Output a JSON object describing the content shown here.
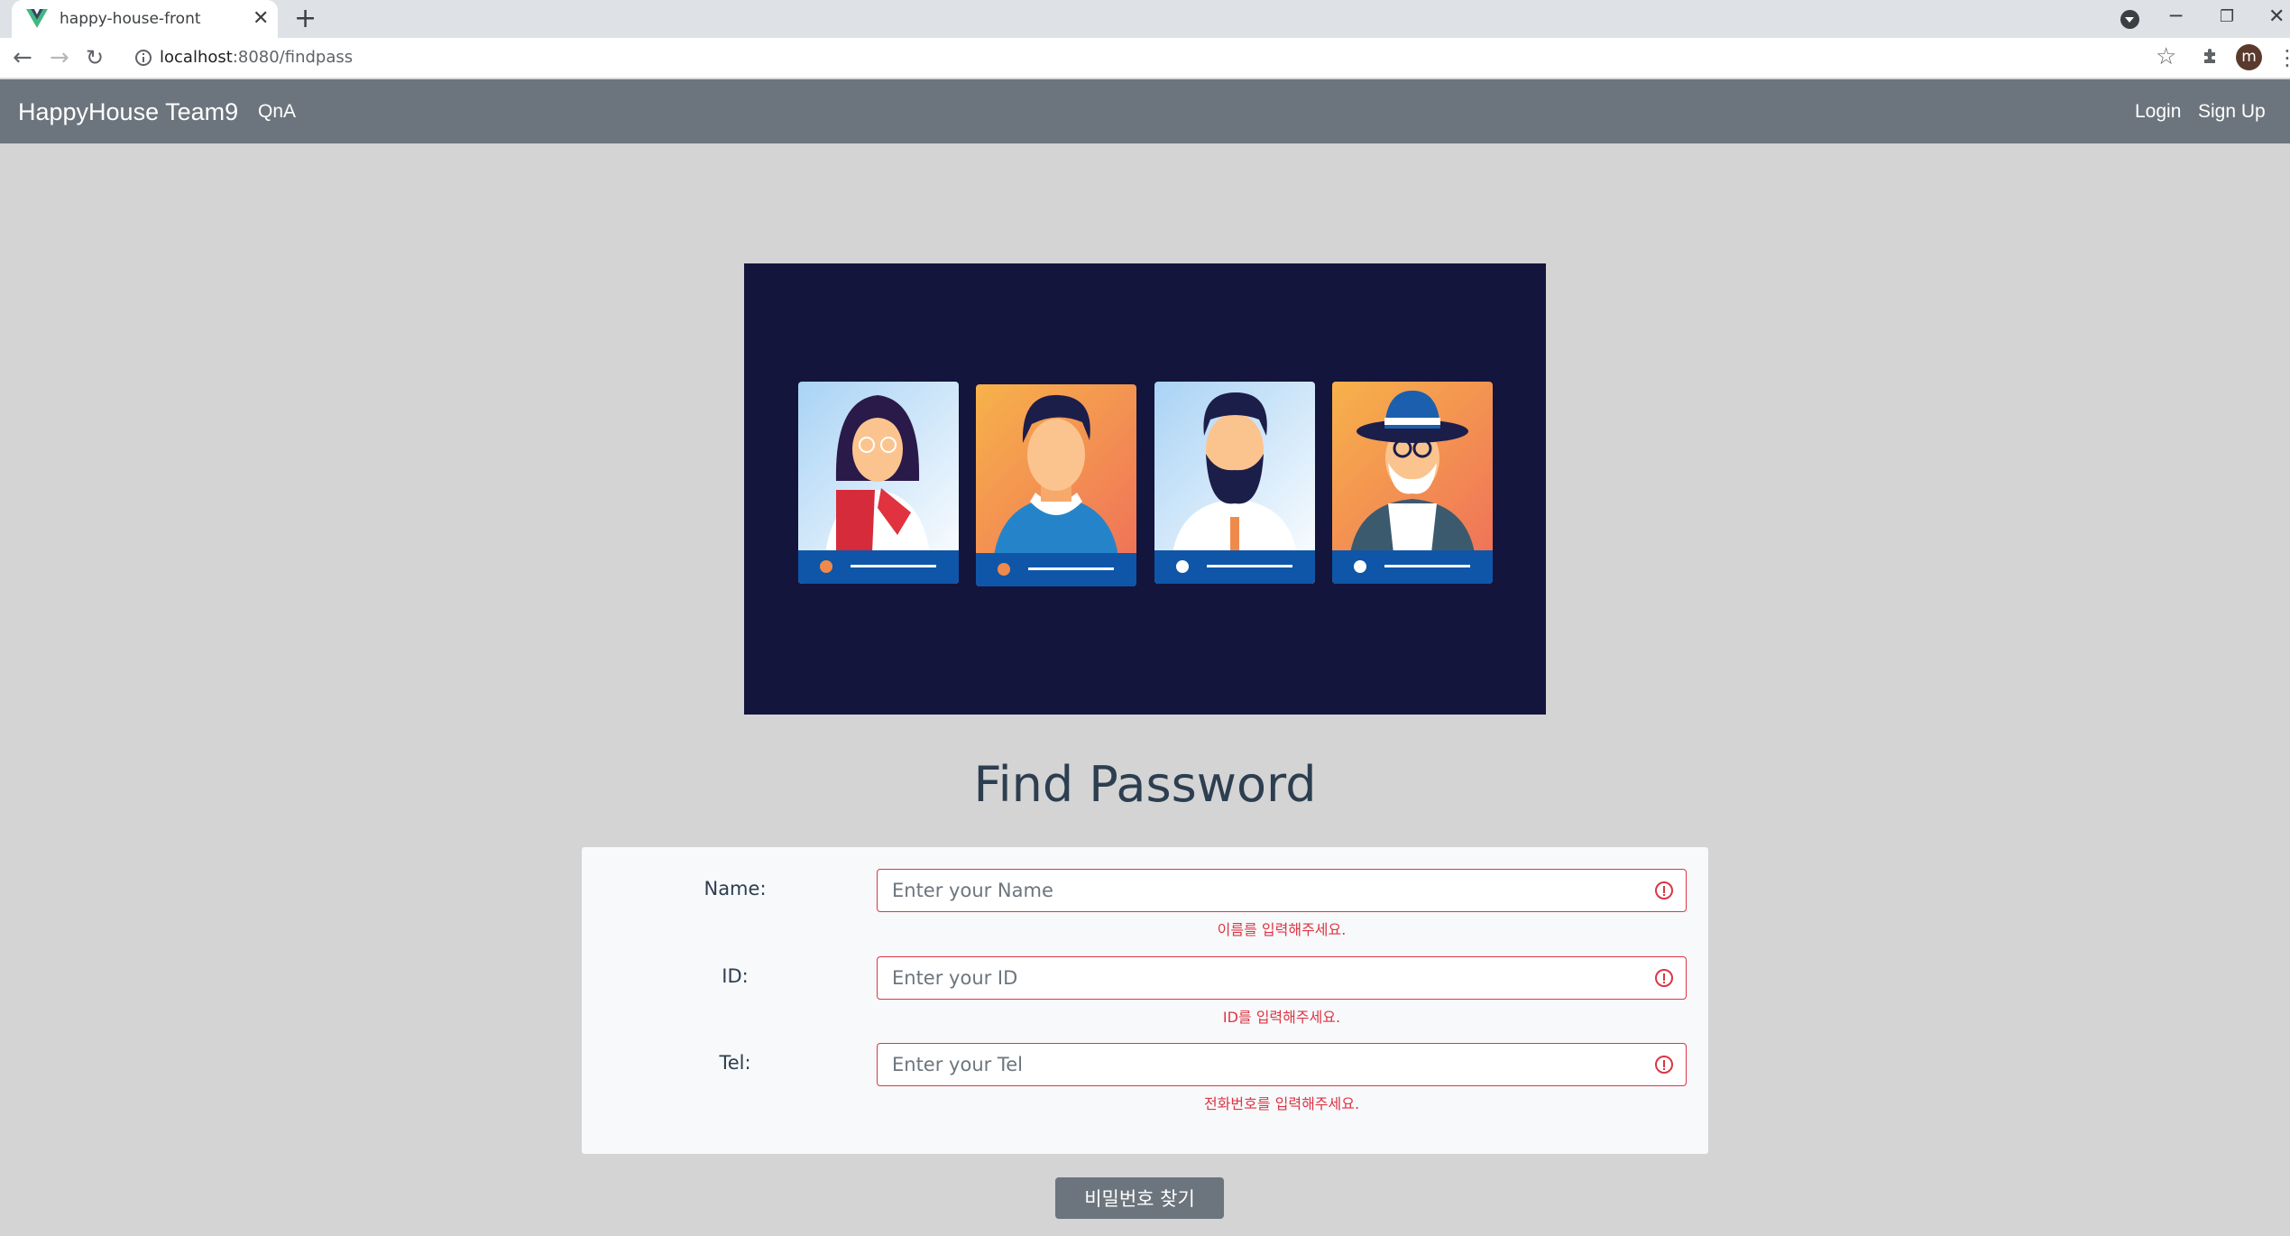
{
  "browser": {
    "tab_title": "happy-house-front",
    "tab_close": "✕",
    "new_tab": "+",
    "url_host": "localhost",
    "url_path": ":8080/findpass",
    "profile_initial": "m",
    "minimize": "─",
    "restore": "❐",
    "close": "✕"
  },
  "navbar": {
    "brand": "HappyHouse Team9",
    "links": [
      "QnA"
    ],
    "login": "Login",
    "signup": "Sign Up",
    "background": "#6c757d"
  },
  "page": {
    "heading": "Find Password"
  },
  "form": {
    "fields": [
      {
        "label": "Name:",
        "placeholder": "Enter your Name",
        "value": "",
        "error": "이름를 입력해주세요."
      },
      {
        "label": "ID:",
        "placeholder": "Enter your ID",
        "value": "",
        "error": "ID를 입력해주세요."
      },
      {
        "label": "Tel:",
        "placeholder": "Enter your Tel",
        "value": "",
        "error": "전화번호를 입력해주세요."
      }
    ],
    "submit_label": "비밀번호 찾기",
    "error_color": "#dc3545"
  },
  "hero": {
    "background": "#13153d",
    "cards": [
      {
        "name": "woman-with-glasses",
        "bg": "#cfe6f7",
        "dot": "#f08a4b"
      },
      {
        "name": "young-man",
        "bg": "#f39a4a",
        "dot": "#f08a4b"
      },
      {
        "name": "bearded-man",
        "bg": "#cfe6f7",
        "dot": "#ffffff"
      },
      {
        "name": "old-man-with-hat",
        "bg": "#f39a4a",
        "dot": "#ffffff"
      }
    ]
  }
}
